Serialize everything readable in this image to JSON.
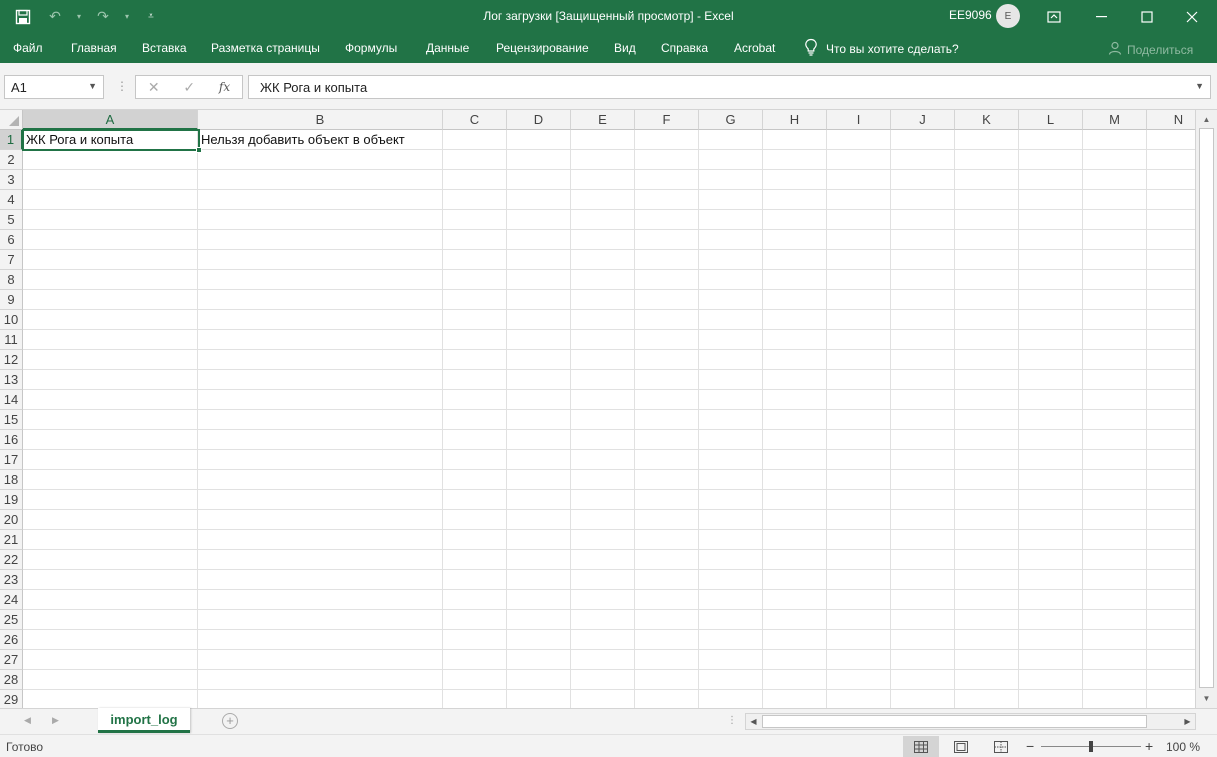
{
  "window": {
    "title": "Лог загрузки  [Защищенный просмотр]  -  Excel",
    "user": "EE9096",
    "avatar_initial": "E"
  },
  "qat": {
    "save_icon": "save-icon",
    "undo_icon": "undo-icon",
    "redo_icon": "redo-icon"
  },
  "menu": {
    "items": [
      "Файл",
      "Главная",
      "Вставка",
      "Разметка страницы",
      "Формулы",
      "Данные",
      "Рецензирование",
      "Вид",
      "Справка",
      "Acrobat"
    ],
    "tell_me": "Что вы хотите сделать?",
    "share": "Поделиться"
  },
  "formula_bar": {
    "name_box": "A1",
    "fx": "fx",
    "content": "ЖК Рога и копыта"
  },
  "grid": {
    "columns": [
      "A",
      "B",
      "C",
      "D",
      "E",
      "F",
      "G",
      "H",
      "I",
      "J",
      "K",
      "L",
      "M",
      "N"
    ],
    "rows": [
      "1",
      "2",
      "3",
      "4",
      "5",
      "6",
      "7",
      "8",
      "9",
      "10",
      "11",
      "12",
      "13",
      "14",
      "15",
      "16",
      "17",
      "18",
      "19",
      "20",
      "21",
      "22",
      "23",
      "24",
      "25",
      "26",
      "27",
      "28",
      "29"
    ],
    "cells": {
      "A1": "ЖК Рога и копыта",
      "B1": "Нельзя добавить объект в объект"
    },
    "selected_cell": "A1"
  },
  "sheets": {
    "tabs": [
      "import_log"
    ],
    "active": "import_log"
  },
  "status": {
    "ready": "Готово",
    "zoom": "100 %"
  },
  "colors": {
    "accent": "#217346",
    "grid_line": "#e1e1e1",
    "header_bg": "#f3f3f3"
  }
}
